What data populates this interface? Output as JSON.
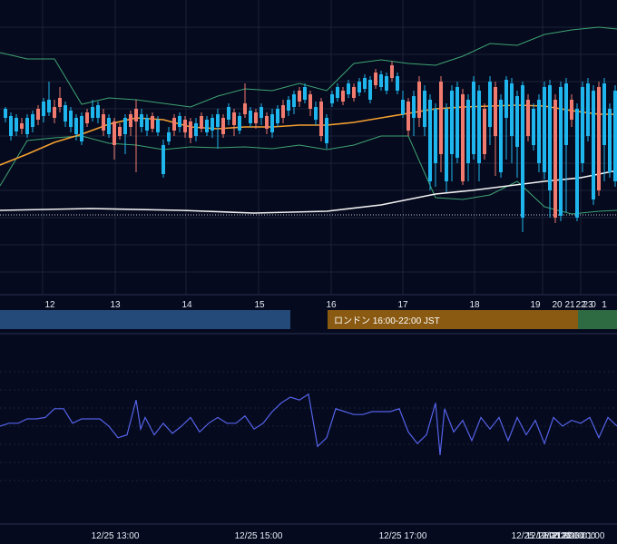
{
  "colors": {
    "background": "#050a1e",
    "grid": "#1b2238",
    "candle_up": "#1fb6ee",
    "candle_down": "#f07b6e",
    "bollinger": "#3fa373",
    "ma_orange": "#f5a030",
    "ma_white": "#f2f2f2",
    "rsi_line": "#5562e8",
    "session_tokyo": "#244a7a",
    "session_london": "#8a5a12",
    "session_ny": "#2e6b42"
  },
  "chart_data": {
    "type": "candlestick",
    "price_panel": {
      "ylim": [
        0,
        325
      ],
      "y_axis_inverted_screen": true,
      "series": [
        {
          "kind": "bollinger_upper",
          "x": [
            0,
            30,
            60,
            90,
            120,
            150,
            180,
            210,
            240,
            270,
            300,
            330,
            360,
            390,
            420,
            450,
            480,
            510,
            540,
            570,
            600,
            630,
            660,
            680
          ],
          "y": [
            58,
            65,
            65,
            115,
            108,
            110,
            114,
            118,
            106,
            98,
            100,
            92,
            100,
            70,
            66,
            70,
            72,
            62,
            48,
            50,
            38,
            33,
            30,
            32
          ]
        },
        {
          "kind": "bollinger_lower",
          "x": [
            0,
            30,
            60,
            90,
            120,
            150,
            180,
            210,
            240,
            270,
            300,
            330,
            360,
            390,
            420,
            450,
            480,
            510,
            540,
            570,
            600,
            630,
            660,
            680
          ],
          "y": [
            205,
            155,
            152,
            150,
            158,
            160,
            165,
            162,
            163,
            162,
            164,
            160,
            165,
            160,
            150,
            150,
            218,
            220,
            215,
            200,
            228,
            236,
            233,
            232
          ]
        },
        {
          "kind": "ma_orange",
          "x": [
            0,
            30,
            60,
            90,
            120,
            150,
            180,
            210,
            240,
            270,
            300,
            330,
            360,
            390,
            420,
            450,
            480,
            510,
            540,
            570,
            600,
            630,
            660,
            680
          ],
          "y": [
            182,
            170,
            157,
            148,
            137,
            130,
            132,
            140,
            142,
            140,
            140,
            138,
            138,
            135,
            130,
            125,
            120,
            118,
            117,
            116,
            117,
            122,
            126,
            126
          ]
        },
        {
          "kind": "ma_white",
          "x": [
            0,
            100,
            200,
            280,
            360,
            420,
            480,
            520,
            560,
            600,
            640,
            680
          ],
          "y": [
            232,
            230,
            232,
            235,
            233,
            226,
            214,
            210,
            205,
            200,
            196,
            188
          ]
        },
        {
          "kind": "dotted_level",
          "y": 237
        }
      ],
      "candles": [
        [
          6,
          120,
          130,
          118,
          135,
          "up"
        ],
        [
          12,
          128,
          150,
          124,
          155,
          "up"
        ],
        [
          18,
          130,
          145,
          126,
          150,
          "up"
        ],
        [
          24,
          136,
          142,
          130,
          148,
          "down"
        ],
        [
          30,
          130,
          148,
          126,
          152,
          "up"
        ],
        [
          36,
          126,
          140,
          122,
          146,
          "up"
        ],
        [
          42,
          120,
          132,
          116,
          138,
          "down"
        ],
        [
          48,
          112,
          128,
          108,
          135,
          "up"
        ],
        [
          54,
          110,
          124,
          90,
          128,
          "up"
        ],
        [
          60,
          118,
          130,
          110,
          136,
          "down"
        ],
        [
          66,
          108,
          118,
          96,
          124,
          "down"
        ],
        [
          72,
          116,
          134,
          112,
          140,
          "up"
        ],
        [
          78,
          122,
          140,
          118,
          146,
          "up"
        ],
        [
          84,
          130,
          148,
          126,
          155,
          "up"
        ],
        [
          90,
          128,
          156,
          124,
          160,
          "up"
        ],
        [
          96,
          124,
          136,
          120,
          140,
          "down"
        ],
        [
          102,
          118,
          130,
          110,
          134,
          "up"
        ],
        [
          108,
          116,
          130,
          112,
          136,
          "up"
        ],
        [
          114,
          126,
          144,
          120,
          150,
          "down"
        ],
        [
          120,
          130,
          148,
          126,
          152,
          "up"
        ],
        [
          126,
          134,
          160,
          130,
          176,
          "down"
        ],
        [
          132,
          140,
          150,
          136,
          154,
          "down"
        ],
        [
          138,
          130,
          148,
          126,
          170,
          "up"
        ],
        [
          144,
          126,
          140,
          122,
          150,
          "down"
        ],
        [
          150,
          120,
          134,
          110,
          190,
          "down"
        ],
        [
          156,
          126,
          140,
          120,
          146,
          "up"
        ],
        [
          162,
          130,
          144,
          126,
          150,
          "up"
        ],
        [
          168,
          128,
          142,
          124,
          146,
          "down"
        ],
        [
          174,
          132,
          146,
          128,
          150,
          "up"
        ],
        [
          180,
          160,
          192,
          154,
          196,
          "up"
        ],
        [
          186,
          146,
          156,
          140,
          160,
          "up"
        ],
        [
          192,
          130,
          144,
          126,
          150,
          "down"
        ],
        [
          198,
          128,
          140,
          124,
          146,
          "up"
        ],
        [
          204,
          132,
          146,
          128,
          152,
          "down"
        ],
        [
          210,
          134,
          152,
          130,
          158,
          "down"
        ],
        [
          216,
          136,
          150,
          130,
          156,
          "up"
        ],
        [
          222,
          128,
          142,
          124,
          146,
          "down"
        ],
        [
          228,
          132,
          146,
          128,
          150,
          "up"
        ],
        [
          234,
          130,
          144,
          126,
          152,
          "up"
        ],
        [
          240,
          126,
          140,
          120,
          164,
          "up"
        ],
        [
          246,
          130,
          148,
          126,
          152,
          "down"
        ],
        [
          252,
          118,
          132,
          114,
          138,
          "up"
        ],
        [
          258,
          124,
          138,
          120,
          150,
          "down"
        ],
        [
          264,
          128,
          144,
          124,
          148,
          "up"
        ],
        [
          270,
          114,
          126,
          92,
          130,
          "down"
        ],
        [
          276,
          122,
          136,
          118,
          140,
          "up"
        ],
        [
          282,
          124,
          136,
          120,
          142,
          "down"
        ],
        [
          288,
          118,
          130,
          114,
          138,
          "up"
        ],
        [
          294,
          128,
          142,
          124,
          148,
          "down"
        ],
        [
          300,
          126,
          146,
          120,
          152,
          "up"
        ],
        [
          306,
          120,
          136,
          116,
          140,
          "up"
        ],
        [
          312,
          116,
          130,
          110,
          136,
          "down"
        ],
        [
          318,
          110,
          122,
          106,
          128,
          "up"
        ],
        [
          324,
          104,
          118,
          100,
          126,
          "up"
        ],
        [
          330,
          100,
          112,
          96,
          118,
          "down"
        ],
        [
          336,
          96,
          110,
          92,
          114,
          "up"
        ],
        [
          342,
          104,
          120,
          100,
          128,
          "down"
        ],
        [
          348,
          118,
          132,
          112,
          138,
          "up"
        ],
        [
          354,
          112,
          150,
          108,
          156,
          "down"
        ],
        [
          360,
          130,
          158,
          126,
          164,
          "up"
        ],
        [
          366,
          104,
          114,
          100,
          118,
          "up"
        ],
        [
          372,
          96,
          108,
          92,
          112,
          "up"
        ],
        [
          378,
          100,
          112,
          96,
          116,
          "down"
        ],
        [
          384,
          92,
          104,
          88,
          108,
          "up"
        ],
        [
          390,
          96,
          108,
          92,
          112,
          "down"
        ],
        [
          396,
          90,
          102,
          86,
          106,
          "up"
        ],
        [
          402,
          86,
          98,
          82,
          102,
          "up"
        ],
        [
          408,
          88,
          110,
          84,
          114,
          "up"
        ],
        [
          414,
          80,
          94,
          76,
          98,
          "down"
        ],
        [
          420,
          82,
          96,
          78,
          100,
          "up"
        ],
        [
          426,
          84,
          100,
          80,
          104,
          "up"
        ],
        [
          432,
          72,
          86,
          68,
          90,
          "down"
        ],
        [
          438,
          84,
          100,
          80,
          104,
          "up"
        ],
        [
          444,
          110,
          126,
          100,
          130,
          "up"
        ],
        [
          450,
          112,
          144,
          108,
          150,
          "down"
        ],
        [
          456,
          106,
          130,
          100,
          150,
          "up"
        ],
        [
          462,
          90,
          130,
          84,
          140,
          "down"
        ],
        [
          468,
          100,
          140,
          94,
          150,
          "up"
        ],
        [
          474,
          110,
          200,
          104,
          210,
          "up"
        ],
        [
          480,
          120,
          180,
          114,
          206,
          "up"
        ],
        [
          486,
          90,
          170,
          84,
          190,
          "down"
        ],
        [
          492,
          120,
          200,
          114,
          212,
          "up"
        ],
        [
          498,
          100,
          170,
          94,
          200,
          "up"
        ],
        [
          504,
          96,
          174,
          90,
          180,
          "up"
        ],
        [
          510,
          104,
          200,
          98,
          204,
          "down"
        ],
        [
          516,
          110,
          180,
          104,
          200,
          "up"
        ],
        [
          522,
          90,
          170,
          84,
          176,
          "up"
        ],
        [
          528,
          100,
          180,
          94,
          200,
          "up"
        ],
        [
          534,
          120,
          170,
          114,
          176,
          "down"
        ],
        [
          540,
          90,
          140,
          84,
          160,
          "up"
        ],
        [
          546,
          96,
          150,
          90,
          194,
          "down"
        ],
        [
          552,
          110,
          190,
          104,
          196,
          "up"
        ],
        [
          558,
          88,
          130,
          84,
          176,
          "up"
        ],
        [
          564,
          92,
          150,
          86,
          180,
          "up"
        ],
        [
          570,
          106,
          162,
          100,
          196,
          "up"
        ],
        [
          576,
          94,
          240,
          90,
          256,
          "up"
        ],
        [
          582,
          110,
          150,
          104,
          156,
          "down"
        ],
        [
          588,
          120,
          160,
          114,
          166,
          "up"
        ],
        [
          594,
          110,
          180,
          104,
          190,
          "up"
        ],
        [
          600,
          96,
          190,
          90,
          198,
          "up"
        ],
        [
          606,
          94,
          210,
          88,
          240,
          "up"
        ],
        [
          612,
          110,
          240,
          104,
          246,
          "down"
        ],
        [
          618,
          96,
          238,
          90,
          244,
          "up"
        ],
        [
          624,
          92,
          160,
          86,
          234,
          "up"
        ],
        [
          630,
          110,
          132,
          104,
          140,
          "down"
        ],
        [
          636,
          120,
          240,
          114,
          244,
          "up"
        ],
        [
          642,
          96,
          180,
          90,
          190,
          "up"
        ],
        [
          648,
          92,
          150,
          86,
          156,
          "up"
        ],
        [
          654,
          100,
          220,
          94,
          226,
          "up"
        ],
        [
          660,
          96,
          210,
          90,
          216,
          "down"
        ],
        [
          666,
          92,
          160,
          86,
          200,
          "up"
        ],
        [
          672,
          120,
          190,
          114,
          196,
          "up"
        ],
        [
          678,
          100,
          200,
          94,
          206,
          "up"
        ]
      ]
    },
    "x_ticks_top": [
      "12",
      "13",
      "14",
      "15",
      "16",
      "17",
      "18",
      "19",
      "20",
      "21",
      "22",
      "23",
      "0",
      "1"
    ],
    "sessions": [
      {
        "label": "",
        "color_key": "session_tokyo"
      },
      {
        "label": "ロンドン 16:00-22:00 JST",
        "color_key": "session_london"
      },
      {
        "label": "",
        "color_key": "session_ny"
      }
    ],
    "oscillator": {
      "type": "line",
      "ylim": [
        0,
        100
      ],
      "x": [
        0,
        10,
        20,
        30,
        40,
        50,
        60,
        70,
        80,
        90,
        100,
        110,
        120,
        130,
        140,
        150,
        155,
        160,
        170,
        180,
        190,
        200,
        210,
        220,
        230,
        240,
        250,
        260,
        270,
        280,
        290,
        300,
        310,
        320,
        330,
        340,
        350,
        360,
        370,
        380,
        390,
        400,
        410,
        420,
        430,
        440,
        450,
        460,
        470,
        480,
        485,
        490,
        500,
        510,
        520,
        530,
        540,
        550,
        560,
        570,
        580,
        590,
        600,
        610,
        620,
        630,
        640,
        650,
        660,
        670,
        680
      ],
      "y": [
        50,
        52,
        52,
        55,
        55,
        56,
        62,
        62,
        52,
        55,
        55,
        55,
        50,
        42,
        44,
        68,
        48,
        56,
        44,
        52,
        45,
        50,
        56,
        46,
        52,
        56,
        52,
        52,
        57,
        48,
        52,
        60,
        66,
        70,
        68,
        72,
        36,
        42,
        62,
        60,
        58,
        58,
        60,
        60,
        60,
        62,
        46,
        38,
        44,
        66,
        30,
        62,
        46,
        54,
        40,
        56,
        48,
        56,
        40,
        56,
        44,
        54,
        38,
        56,
        50,
        54,
        52,
        56,
        42,
        56,
        50
      ]
    },
    "x_ticks_bottom": [
      "12/25 13:00",
      "12/25 15:00",
      "12/25 17:00",
      "12/25 19:00",
      "12/25 21:00",
      "12/25 22:00",
      "12/26 00:00",
      "12/26 01:00"
    ]
  }
}
